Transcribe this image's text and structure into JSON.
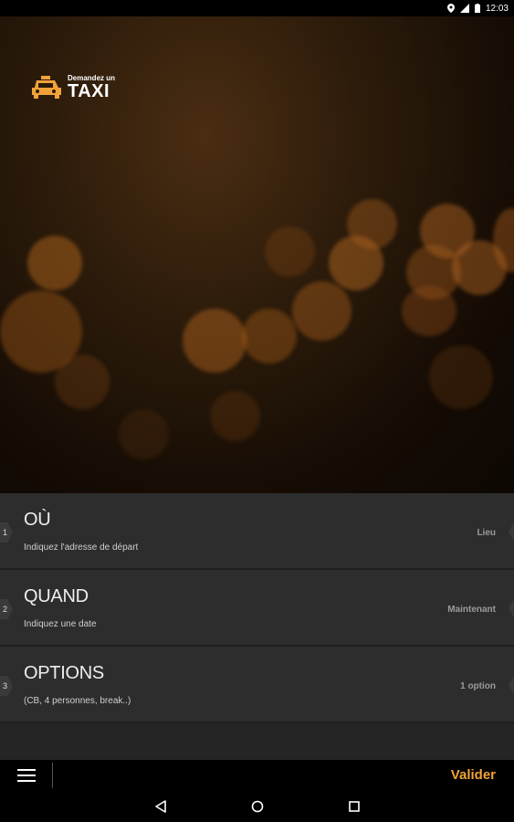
{
  "status_bar": {
    "time": "12:03"
  },
  "logo": {
    "line1": "Demandez un",
    "line2": "TAXI"
  },
  "rows": [
    {
      "num": "1",
      "title": "OÙ",
      "subtitle": "Indiquez l'adresse de départ",
      "value": "Lieu"
    },
    {
      "num": "2",
      "title": "QUAND",
      "subtitle": "Indiquez une date",
      "value": "Maintenant"
    },
    {
      "num": "3",
      "title": "OPTIONS",
      "subtitle": "(CB, 4 personnes, break..)",
      "value": "1 option"
    }
  ],
  "action_bar": {
    "validate_label": "Valider"
  },
  "colors": {
    "accent": "#f2a23a",
    "row_bg": "#2d2d2d"
  }
}
